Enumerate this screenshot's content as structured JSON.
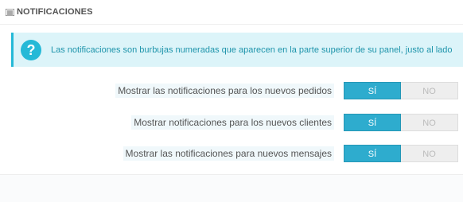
{
  "panel": {
    "title": "NOTIFICACIONES",
    "title_icon": "list-icon"
  },
  "alert": {
    "icon": "question-icon",
    "text": "Las notificaciones son burbujas numeradas que aparecen en la parte superior de su panel, justo al lado",
    "accent": "#25b9d7"
  },
  "settings": [
    {
      "label": "Mostrar las notificaciones para los nuevos pedidos",
      "yes": "SÍ",
      "no": "NO",
      "value": "yes"
    },
    {
      "label": "Mostrar notificaciones para los nuevos clientes",
      "yes": "SÍ",
      "no": "NO",
      "value": "yes"
    },
    {
      "label": "Mostrar las notificaciones para nuevos mensajes",
      "yes": "SÍ",
      "no": "NO",
      "value": "yes"
    }
  ],
  "colors": {
    "switch_on": "#2eacce",
    "switch_off": "#eeeeee"
  }
}
